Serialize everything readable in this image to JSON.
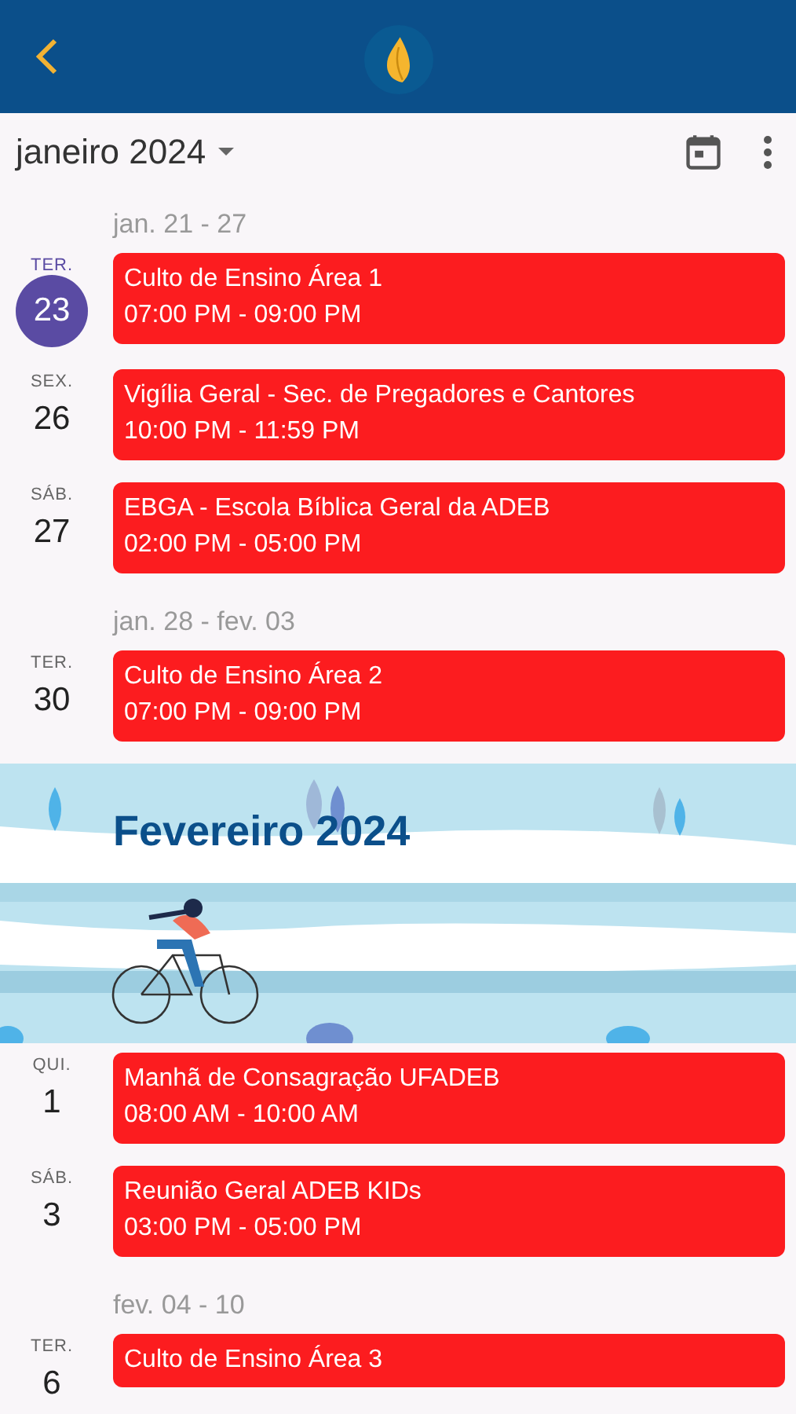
{
  "month_selector": {
    "label": "janeiro 2024"
  },
  "agenda": [
    {
      "kind": "week",
      "label": "jan. 21 - 27"
    },
    {
      "kind": "day",
      "weekday": "TER.",
      "day": "23",
      "selected": true,
      "events": [
        {
          "title": "Culto de Ensino Área 1",
          "time": "07:00 PM - 09:00 PM",
          "color": "#fc1c1f"
        }
      ]
    },
    {
      "kind": "day",
      "weekday": "SEX.",
      "day": "26",
      "selected": false,
      "events": [
        {
          "title": "Vigília Geral - Sec. de Pregadores e Cantores",
          "time": "10:00 PM - 11:59 PM",
          "color": "#fc1c1f"
        }
      ]
    },
    {
      "kind": "day",
      "weekday": "SÁB.",
      "day": "27",
      "selected": false,
      "events": [
        {
          "title": "EBGA - Escola Bíblica Geral da ADEB",
          "time": "02:00 PM - 05:00 PM",
          "color": "#fc1c1f"
        }
      ]
    },
    {
      "kind": "week",
      "label": "jan. 28 - fev. 03"
    },
    {
      "kind": "day",
      "weekday": "TER.",
      "day": "30",
      "selected": false,
      "events": [
        {
          "title": "Culto de Ensino Área 2",
          "time": "07:00 PM - 09:00 PM",
          "color": "#fc1c1f"
        }
      ]
    },
    {
      "kind": "month",
      "label": "Fevereiro 2024"
    },
    {
      "kind": "day",
      "weekday": "QUI.",
      "day": "1",
      "selected": false,
      "events": [
        {
          "title": "Manhã de Consagração UFADEB",
          "time": "08:00 AM - 10:00 AM",
          "color": "#fc1c1f"
        }
      ]
    },
    {
      "kind": "day",
      "weekday": "SÁB.",
      "day": "3",
      "selected": false,
      "events": [
        {
          "title": "Reunião Geral ADEB KIDs",
          "time": "03:00 PM - 05:00 PM",
          "color": "#fc1c1f"
        }
      ]
    },
    {
      "kind": "week",
      "label": "fev. 04 - 10"
    },
    {
      "kind": "day",
      "weekday": "TER.",
      "day": "6",
      "selected": false,
      "events": [
        {
          "title": "Culto de Ensino Área 3",
          "color": "#fc1c1f"
        }
      ]
    }
  ]
}
